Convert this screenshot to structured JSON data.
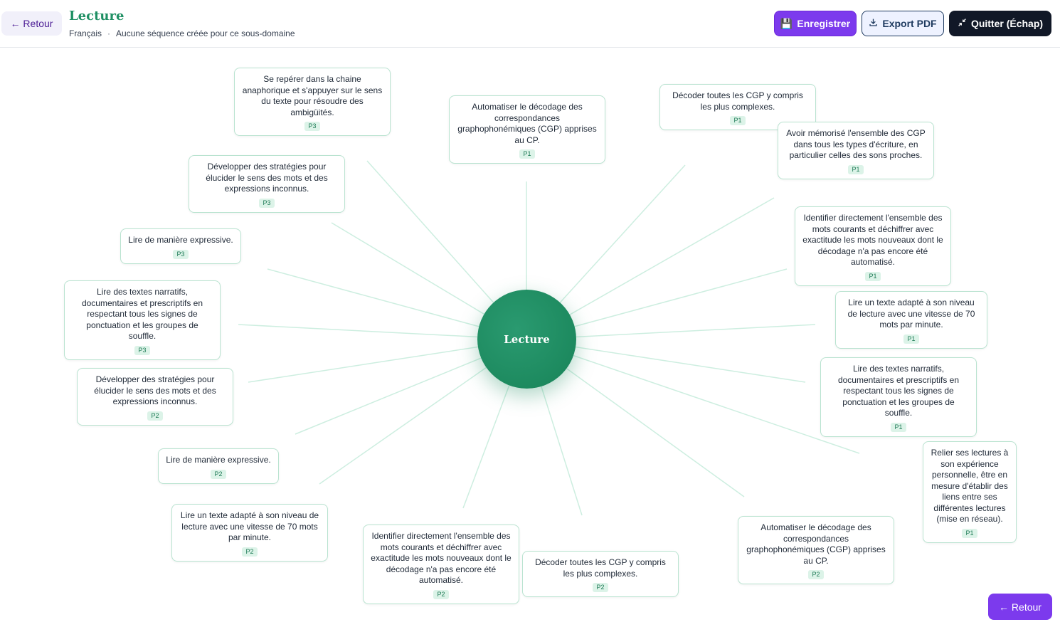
{
  "header": {
    "back_label": "← Retour",
    "title": "Lecture",
    "subject": "Français",
    "separator": "·",
    "status": "Aucune séquence créée pour ce sous-domaine",
    "save_icon": "💾",
    "save_label": "Enregistrer",
    "export_icon": "download-icon",
    "export_label": "Export PDF",
    "quit_icon": "compress-arrows-icon",
    "quit_label": "Quitter (Échap)"
  },
  "mindmap": {
    "center_label": "Lecture",
    "line_color": "#cdeee0",
    "accent": "#1d8a5f",
    "nodes": [
      {
        "text": "Se repérer dans la chaine anaphorique et s'appuyer sur le sens du texte pour résoudre des ambigüités.",
        "badge": "P3"
      },
      {
        "text": "Automatiser le décodage des correspondances graphophonémiques (CGP) apprises au CP.",
        "badge": "P1"
      },
      {
        "text": "Décoder toutes les CGP y compris les plus complexes.",
        "badge": "P1"
      },
      {
        "text": "Avoir mémorisé l'ensemble des CGP dans tous les types d'écriture, en particulier celles des sons proches.",
        "badge": "P1"
      },
      {
        "text": "Développer des stratégies pour élucider le sens des mots et des expressions inconnus.",
        "badge": "P3"
      },
      {
        "text": "Identifier directement l'ensemble des mots courants et déchiffrer avec exactitude les mots nouveaux dont le décodage n'a pas encore été automatisé.",
        "badge": "P1"
      },
      {
        "text": "Lire de manière expressive.",
        "badge": "P3"
      },
      {
        "text": "Lire un texte adapté à son niveau de lecture avec une vitesse de 70 mots par minute.",
        "badge": "P1"
      },
      {
        "text": "Lire des textes narratifs, documentaires et prescriptifs en respectant tous les signes de ponctuation et les groupes de souffle.",
        "badge": "P3"
      },
      {
        "text": "Lire des textes narratifs, documentaires et prescriptifs en respectant tous les signes de ponctuation et les groupes de souffle.",
        "badge": "P1"
      },
      {
        "text": "Développer des stratégies pour élucider le sens des mots et des expressions inconnus.",
        "badge": "P2"
      },
      {
        "text": "Relier ses lectures à son expérience personnelle, être en mesure d'établir des liens entre ses différentes lectures (mise en réseau).",
        "badge": "P1"
      },
      {
        "text": "Lire de manière expressive.",
        "badge": "P2"
      },
      {
        "text": "Lire un texte adapté à son niveau de lecture avec une vitesse de 70 mots par minute.",
        "badge": "P2"
      },
      {
        "text": "Automatiser le décodage des correspondances graphophonémiques (CGP) apprises au CP.",
        "badge": "P2"
      },
      {
        "text": "Identifier directement l'ensemble des mots courants et déchiffrer avec exactitude les mots nouveaux dont le décodage n'a pas encore été automatisé.",
        "badge": "P2"
      },
      {
        "text": "Décoder toutes les CGP y compris les plus complexes.",
        "badge": "P2"
      }
    ]
  },
  "footer": {
    "back_label": "← Retour"
  }
}
